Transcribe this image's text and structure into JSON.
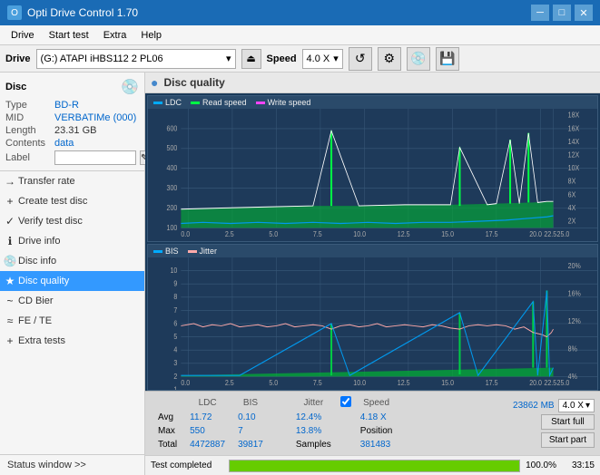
{
  "titlebar": {
    "title": "Opti Drive Control 1.70",
    "controls": {
      "minimize": "─",
      "maximize": "□",
      "close": "✕"
    }
  },
  "menubar": {
    "items": [
      "Drive",
      "Start test",
      "Extra",
      "Help"
    ]
  },
  "drivebar": {
    "label": "Drive",
    "drive_value": "(G:) ATAPI iHBS112 2 PL06",
    "speed_label": "Speed",
    "speed_value": "4.0 X"
  },
  "disc": {
    "type_label": "Type",
    "type_val": "BD-R",
    "mid_label": "MID",
    "mid_val": "VERBATIMe (000)",
    "length_label": "Length",
    "length_val": "23.31 GB",
    "contents_label": "Contents",
    "contents_val": "data",
    "label_label": "Label",
    "label_val": ""
  },
  "nav": {
    "items": [
      {
        "id": "transfer-rate",
        "label": "Transfer rate",
        "icon": "→"
      },
      {
        "id": "create-test-disc",
        "label": "Create test disc",
        "icon": "+"
      },
      {
        "id": "verify-test-disc",
        "label": "Verify test disc",
        "icon": "✓"
      },
      {
        "id": "drive-info",
        "label": "Drive info",
        "icon": "i"
      },
      {
        "id": "disc-info",
        "label": "Disc info",
        "icon": "💿"
      },
      {
        "id": "disc-quality",
        "label": "Disc quality",
        "icon": "★",
        "active": true
      },
      {
        "id": "cd-bier",
        "label": "CD Bier",
        "icon": "~"
      },
      {
        "id": "fe-te",
        "label": "FE / TE",
        "icon": "≈"
      },
      {
        "id": "extra-tests",
        "label": "Extra tests",
        "icon": "+"
      }
    ]
  },
  "status_window": {
    "label": "Status window >>"
  },
  "content": {
    "title": "Disc quality",
    "chart1": {
      "legend": [
        "LDC",
        "Read speed",
        "Write speed"
      ],
      "y_max": 600,
      "y_right_max": 18,
      "x_max": 25,
      "x_labels": [
        "0.0",
        "2.5",
        "5.0",
        "7.5",
        "10.0",
        "12.5",
        "15.0",
        "17.5",
        "20.0",
        "22.5",
        "25.0"
      ],
      "y_right_labels": [
        "18X",
        "16X",
        "14X",
        "12X",
        "10X",
        "8X",
        "6X",
        "4X",
        "2X"
      ],
      "y_left_labels": [
        "600",
        "500",
        "400",
        "300",
        "200",
        "100"
      ]
    },
    "chart2": {
      "legend": [
        "BIS",
        "Jitter"
      ],
      "y_max": 10,
      "y_right_max": 20,
      "x_max": 25,
      "x_labels": [
        "0.0",
        "2.5",
        "5.0",
        "7.5",
        "10.0",
        "12.5",
        "15.0",
        "17.5",
        "20.0",
        "22.5",
        "25.0"
      ],
      "y_right_labels": [
        "20%",
        "16%",
        "12%",
        "8%",
        "4%"
      ],
      "y_left_labels": [
        "10",
        "9",
        "8",
        "7",
        "6",
        "5",
        "4",
        "3",
        "2",
        "1"
      ]
    }
  },
  "stats": {
    "col_headers": [
      "",
      "LDC",
      "BIS",
      "",
      "Jitter",
      "Speed",
      ""
    ],
    "avg_label": "Avg",
    "avg_ldc": "11.72",
    "avg_bis": "0.10",
    "avg_jitter": "12.4%",
    "avg_speed": "4.18 X",
    "speed_select": "4.0 X",
    "max_label": "Max",
    "max_ldc": "550",
    "max_bis": "7",
    "max_jitter": "13.8%",
    "position_label": "Position",
    "position_val": "23862 MB",
    "total_label": "Total",
    "total_ldc": "4472887",
    "total_bis": "39817",
    "samples_label": "Samples",
    "samples_val": "381483",
    "jitter_checked": true,
    "btn_start_full": "Start full",
    "btn_start_part": "Start part"
  },
  "bottom": {
    "status_label": "Test completed",
    "progress": 100,
    "progress_text": "100.0%",
    "time": "33:15"
  }
}
